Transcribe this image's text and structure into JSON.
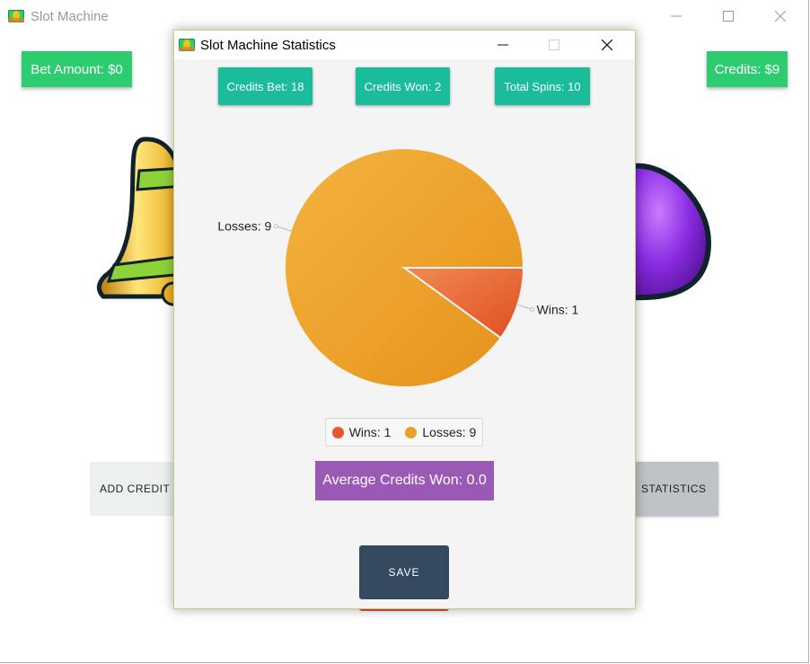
{
  "main_window": {
    "title": "Slot Machine",
    "bet_amount": "Bet Amount: $0",
    "credits": "Credits: $9",
    "add_credit": "ADD CREDIT",
    "statistics": "STATISTICS",
    "colors": {
      "green": "#2ecc71",
      "red_button_edge": "#e74c3c"
    }
  },
  "dialog": {
    "title": "Slot Machine Statistics",
    "credits_bet": "Credits Bet: 18",
    "credits_won": "Credits Won: 2",
    "total_spins": "Total Spins: 10",
    "average": "Average Credits Won: 0.0",
    "save": "SAVE",
    "colors": {
      "teal": "#1abc9c",
      "purple": "#9b59b6",
      "navy": "#34495e"
    }
  },
  "chart_data": {
    "type": "pie",
    "slices": [
      {
        "label": "Wins: 1",
        "name": "Wins",
        "value": 1,
        "color": "#e4582b"
      },
      {
        "label": "Losses: 9",
        "name": "Losses",
        "value": 9,
        "color": "#e9a127"
      }
    ],
    "legend": {
      "placement": "bottom",
      "entries": [
        "Wins: 1",
        "Losses: 9"
      ]
    }
  }
}
